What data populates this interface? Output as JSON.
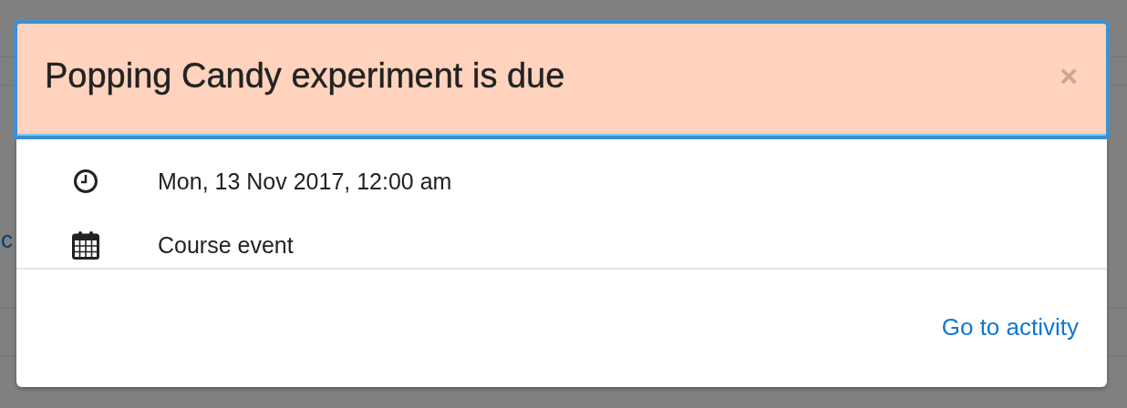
{
  "background": {
    "link_fragment": "c"
  },
  "modal": {
    "title": "Popping Candy experiment is due",
    "close": "×",
    "focused": true,
    "details": [
      {
        "kind": "time",
        "text": "Mon, 13 Nov 2017, 12:00 am"
      },
      {
        "kind": "calendar",
        "text": "Course event"
      }
    ],
    "action": "Go to activity"
  }
}
